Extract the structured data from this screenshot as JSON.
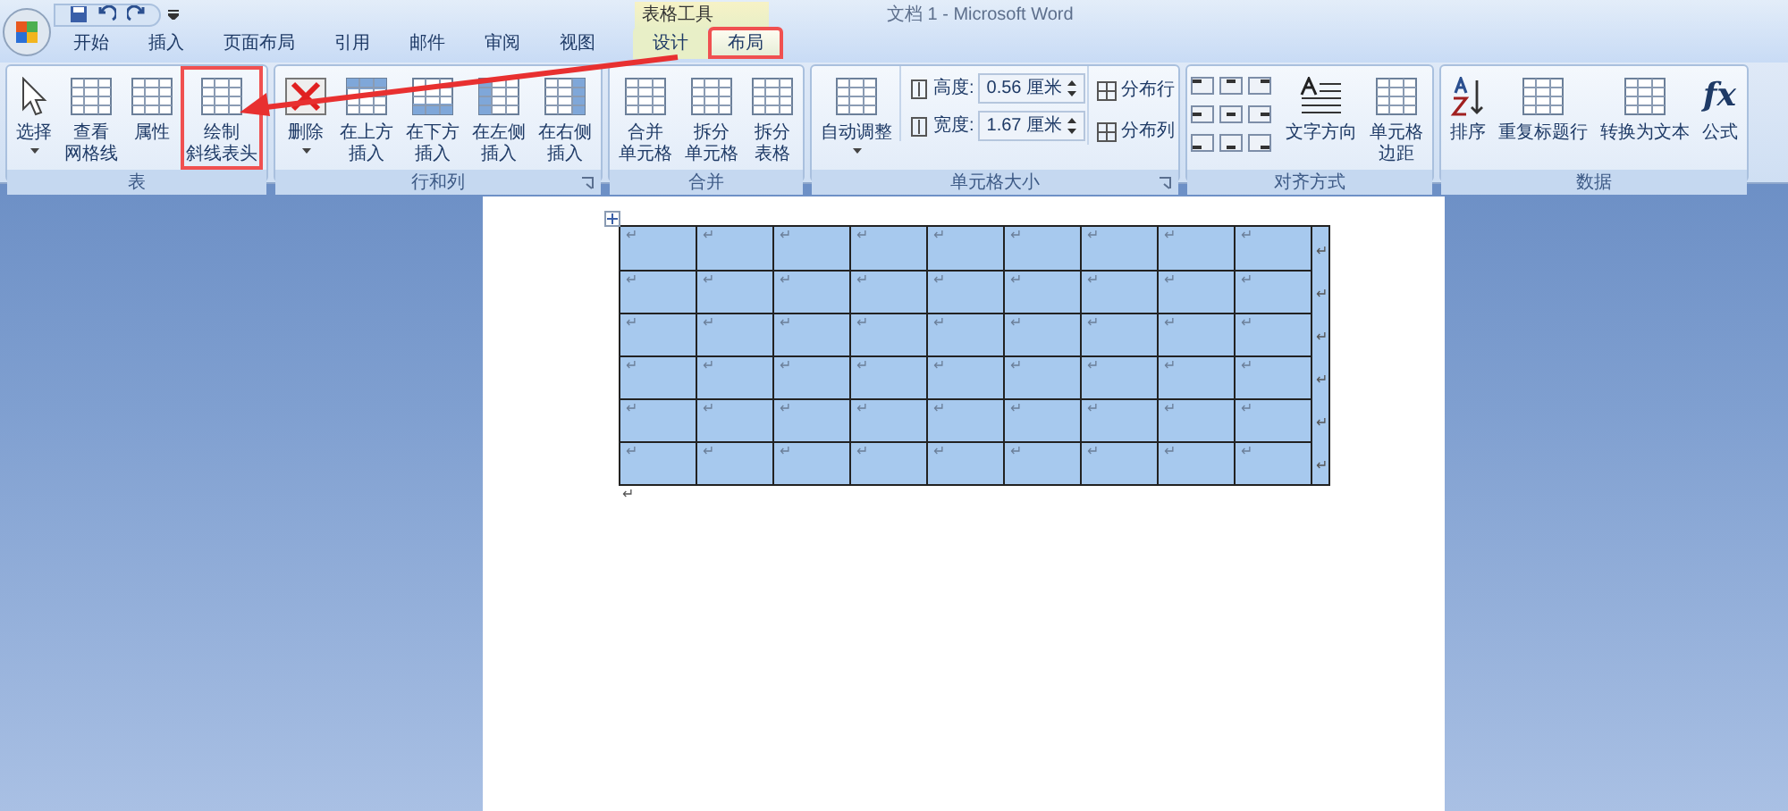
{
  "window": {
    "title": "文档 1 - Microsoft Word"
  },
  "contextual_group": "表格工具",
  "tabs": [
    {
      "label": "开始",
      "selected": false,
      "contextual": false,
      "highlighted": false
    },
    {
      "label": "插入",
      "selected": false,
      "contextual": false,
      "highlighted": false
    },
    {
      "label": "页面布局",
      "selected": false,
      "contextual": false,
      "highlighted": false
    },
    {
      "label": "引用",
      "selected": false,
      "contextual": false,
      "highlighted": false
    },
    {
      "label": "邮件",
      "selected": false,
      "contextual": false,
      "highlighted": false
    },
    {
      "label": "审阅",
      "selected": false,
      "contextual": false,
      "highlighted": false
    },
    {
      "label": "视图",
      "selected": false,
      "contextual": false,
      "highlighted": false
    },
    {
      "label": "设计",
      "selected": false,
      "contextual": true,
      "highlighted": false
    },
    {
      "label": "布局",
      "selected": true,
      "contextual": true,
      "highlighted": true
    }
  ],
  "ribbon": {
    "groups": [
      {
        "label": "表",
        "launcher": false,
        "items": [
          {
            "kind": "large",
            "lines": [
              "选择"
            ],
            "dropdown": true,
            "highlighted": false
          },
          {
            "kind": "large",
            "lines": [
              "查看",
              "网格线"
            ],
            "dropdown": false,
            "highlighted": false
          },
          {
            "kind": "large",
            "lines": [
              "属性"
            ],
            "dropdown": false,
            "highlighted": false
          },
          {
            "kind": "large",
            "lines": [
              "绘制",
              "斜线表头"
            ],
            "dropdown": false,
            "highlighted": true
          }
        ]
      },
      {
        "label": "行和列",
        "launcher": true,
        "items": [
          {
            "kind": "large",
            "lines": [
              "删除"
            ],
            "dropdown": true,
            "highlighted": false
          },
          {
            "kind": "large",
            "lines": [
              "在上方",
              "插入"
            ],
            "dropdown": false,
            "highlighted": false
          },
          {
            "kind": "large",
            "lines": [
              "在下方",
              "插入"
            ],
            "dropdown": false,
            "highlighted": false
          },
          {
            "kind": "large",
            "lines": [
              "在左侧",
              "插入"
            ],
            "dropdown": false,
            "highlighted": false
          },
          {
            "kind": "large",
            "lines": [
              "在右侧",
              "插入"
            ],
            "dropdown": false,
            "highlighted": false
          }
        ]
      },
      {
        "label": "合并",
        "launcher": false,
        "items": [
          {
            "kind": "large",
            "lines": [
              "合并",
              "单元格"
            ],
            "dropdown": false,
            "highlighted": false
          },
          {
            "kind": "large",
            "lines": [
              "拆分",
              "单元格"
            ],
            "dropdown": false,
            "highlighted": false
          },
          {
            "kind": "large",
            "lines": [
              "拆分",
              "表格"
            ],
            "dropdown": false,
            "highlighted": false
          }
        ]
      },
      {
        "label": "单元格大小",
        "launcher": true,
        "items": [
          {
            "kind": "large",
            "lines": [
              "自动调整"
            ],
            "dropdown": true,
            "highlighted": false
          },
          {
            "kind": "fields",
            "fields": [
              {
                "label": "高度:",
                "value": "0.56 厘米"
              },
              {
                "label": "宽度:",
                "value": "1.67 厘米"
              }
            ]
          },
          {
            "kind": "small",
            "buttons": [
              "分布行",
              "分布列"
            ]
          }
        ]
      },
      {
        "label": "对齐方式",
        "launcher": false,
        "items": [
          {
            "kind": "align_grid"
          },
          {
            "kind": "large",
            "lines": [
              "文字方向"
            ],
            "dropdown": false,
            "highlighted": false
          },
          {
            "kind": "large",
            "lines": [
              "单元格",
              "边距"
            ],
            "dropdown": false,
            "highlighted": false
          }
        ]
      },
      {
        "label": "数据",
        "launcher": false,
        "items": [
          {
            "kind": "large",
            "lines": [
              "排序"
            ],
            "dropdown": false,
            "highlighted": false
          },
          {
            "kind": "large",
            "lines": [
              "重复标题行"
            ],
            "dropdown": false,
            "highlighted": false
          },
          {
            "kind": "large",
            "lines": [
              "转换为文本"
            ],
            "dropdown": false,
            "highlighted": false
          },
          {
            "kind": "large",
            "lines": [
              "公式"
            ],
            "dropdown": false,
            "highlighted": false,
            "glyph": "fx"
          }
        ]
      }
    ]
  },
  "document": {
    "table": {
      "rows": [
        {
          "cells": [
            "↵",
            "↵",
            "↵",
            "↵",
            "↵",
            "↵",
            "↵",
            "↵",
            "↵"
          ],
          "end": "↵"
        },
        {
          "cells": [
            "↵",
            "↵",
            "↵",
            "↵",
            "↵",
            "↵",
            "↵",
            "↵",
            "↵"
          ],
          "end": "↵"
        },
        {
          "cells": [
            "↵",
            "↵",
            "↵",
            "↵",
            "↵",
            "↵",
            "↵",
            "↵",
            "↵"
          ],
          "end": "↵"
        },
        {
          "cells": [
            "↵",
            "↵",
            "↵",
            "↵",
            "↵",
            "↵",
            "↵",
            "↵",
            "↵"
          ],
          "end": "↵"
        },
        {
          "cells": [
            "↵",
            "↵",
            "↵",
            "↵",
            "↵",
            "↵",
            "↵",
            "↵",
            "↵"
          ],
          "end": "↵"
        },
        {
          "cells": [
            "↵",
            "↵",
            "↵",
            "↵",
            "↵",
            "↵",
            "↵",
            "↵",
            "↵"
          ],
          "end": "↵"
        }
      ],
      "selected": true
    },
    "after_mark": "↵"
  }
}
